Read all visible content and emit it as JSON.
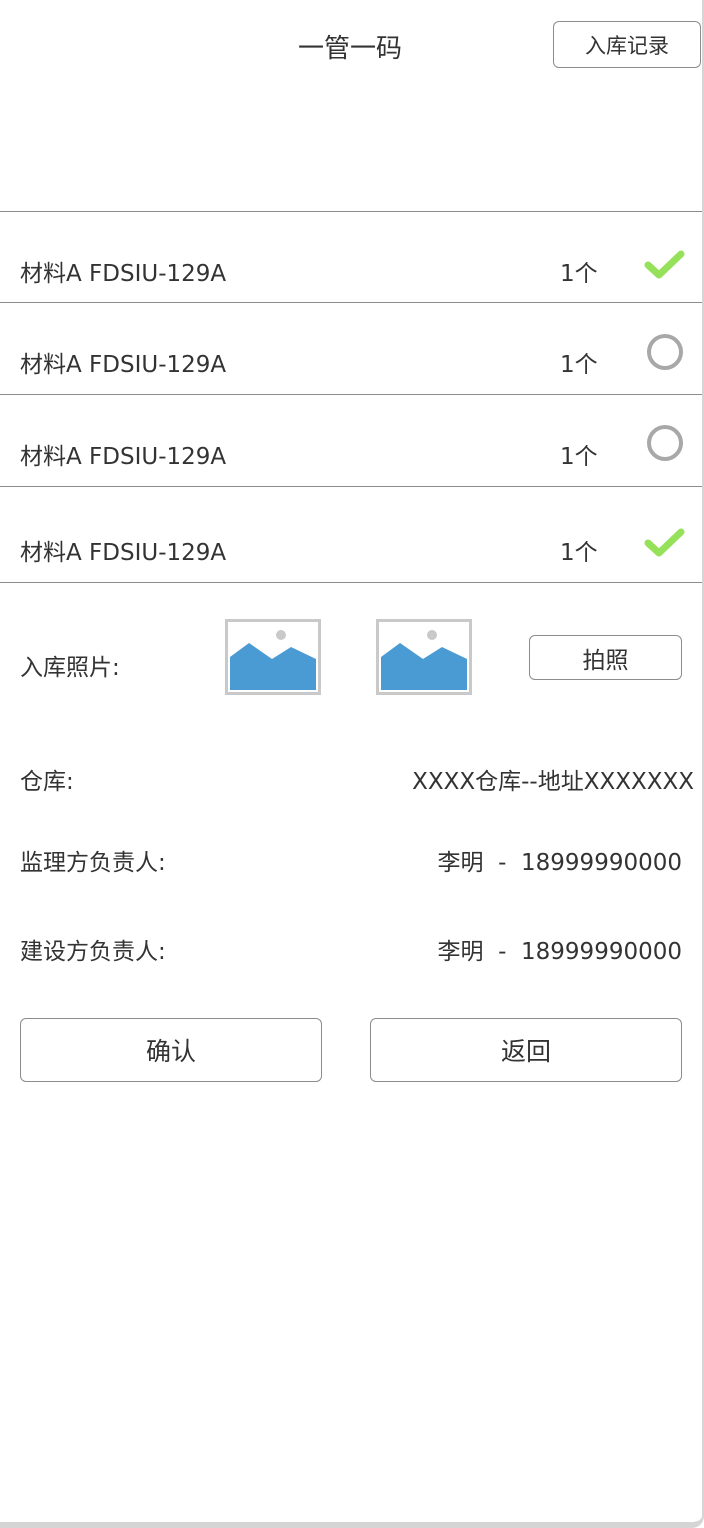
{
  "header": {
    "title": "一管一码",
    "records_label": "入库记录"
  },
  "items": [
    {
      "name": "材料A FDSIU-129A",
      "qty": "1个",
      "status": "checked",
      "status_icon": "check-icon"
    },
    {
      "name": "材料A FDSIU-129A",
      "qty": "1个",
      "status": "unchecked",
      "status_icon": "circle-icon"
    },
    {
      "name": "材料A FDSIU-129A",
      "qty": "1个",
      "status": "unchecked",
      "status_icon": "circle-icon"
    },
    {
      "name": "材料A FDSIU-129A",
      "qty": "1个",
      "status": "checked",
      "status_icon": "check-icon"
    }
  ],
  "photos": {
    "label": "入库照片:",
    "thumbnail_icon": "image-placeholder-icon",
    "take_photo_label": "拍照"
  },
  "details": {
    "warehouse_label": "仓库:",
    "warehouse_value": "XXXX仓库--地址XXXXXXX",
    "supervisor_label": "监理方负责人:",
    "supervisor_value": "李明  -  18999990000",
    "builder_label": "建设方负责人:",
    "builder_value": "李明  -  18999990000"
  },
  "actions": {
    "confirm_label": "确认",
    "back_label": "返回"
  },
  "colors": {
    "check": "#95e15a",
    "circle": "#a8a8a8",
    "image_sky": "#4a9ad4",
    "divider": "#8c8c8c"
  }
}
